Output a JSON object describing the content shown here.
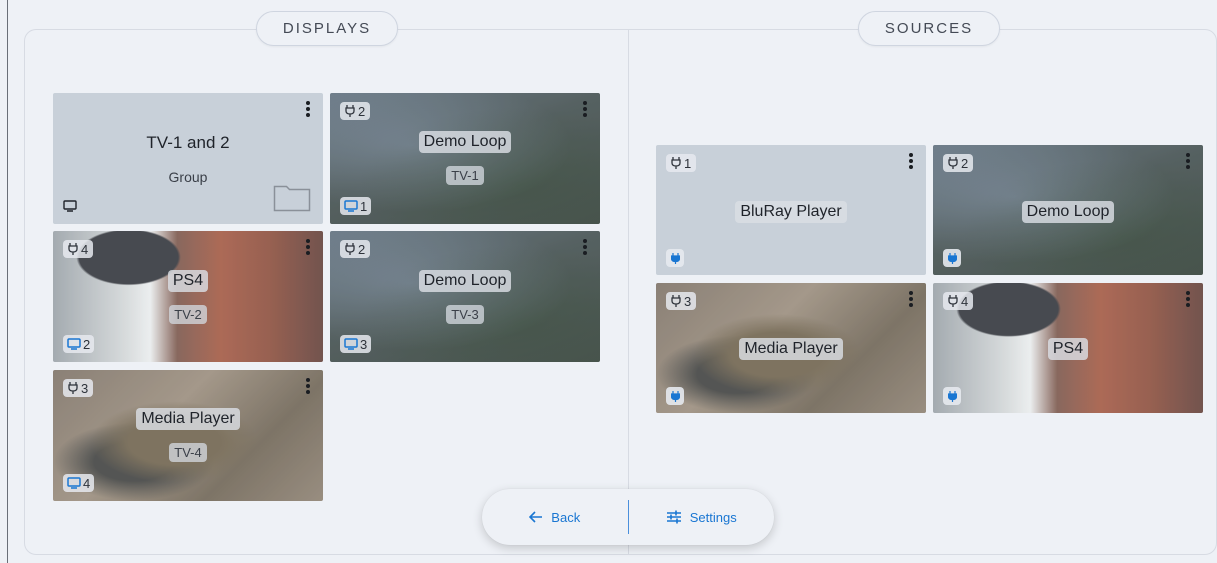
{
  "sections": {
    "displays_title": "DISPLAYS",
    "sources_title": "SOURCES"
  },
  "displays": {
    "group": {
      "name": "TV-1 and 2",
      "subtitle": "Group"
    },
    "tiles": [
      {
        "source_num": "2",
        "title": "Demo Loop",
        "display": "TV-1",
        "screen_num": "1"
      },
      {
        "source_num": "4",
        "title": "PS4",
        "display": "TV-2",
        "screen_num": "2"
      },
      {
        "source_num": "2",
        "title": "Demo Loop",
        "display": "TV-3",
        "screen_num": "3"
      },
      {
        "source_num": "3",
        "title": "Media Player",
        "display": "TV-4",
        "screen_num": "4"
      }
    ]
  },
  "sources": {
    "tiles": [
      {
        "num": "1",
        "name": "BluRay Player"
      },
      {
        "num": "2",
        "name": "Demo Loop"
      },
      {
        "num": "3",
        "name": "Media Player"
      },
      {
        "num": "4",
        "name": "PS4"
      }
    ]
  },
  "bottom_bar": {
    "back_label": "Back",
    "settings_label": "Settings"
  },
  "colors": {
    "accent": "#1976d2",
    "background": "#eef1f6",
    "plain_tile": "#c8d0d9"
  },
  "icons": [
    "plug-icon",
    "menu-dots-icon",
    "monitor-icon",
    "folder-icon",
    "arrow-left-icon",
    "sliders-icon"
  ]
}
